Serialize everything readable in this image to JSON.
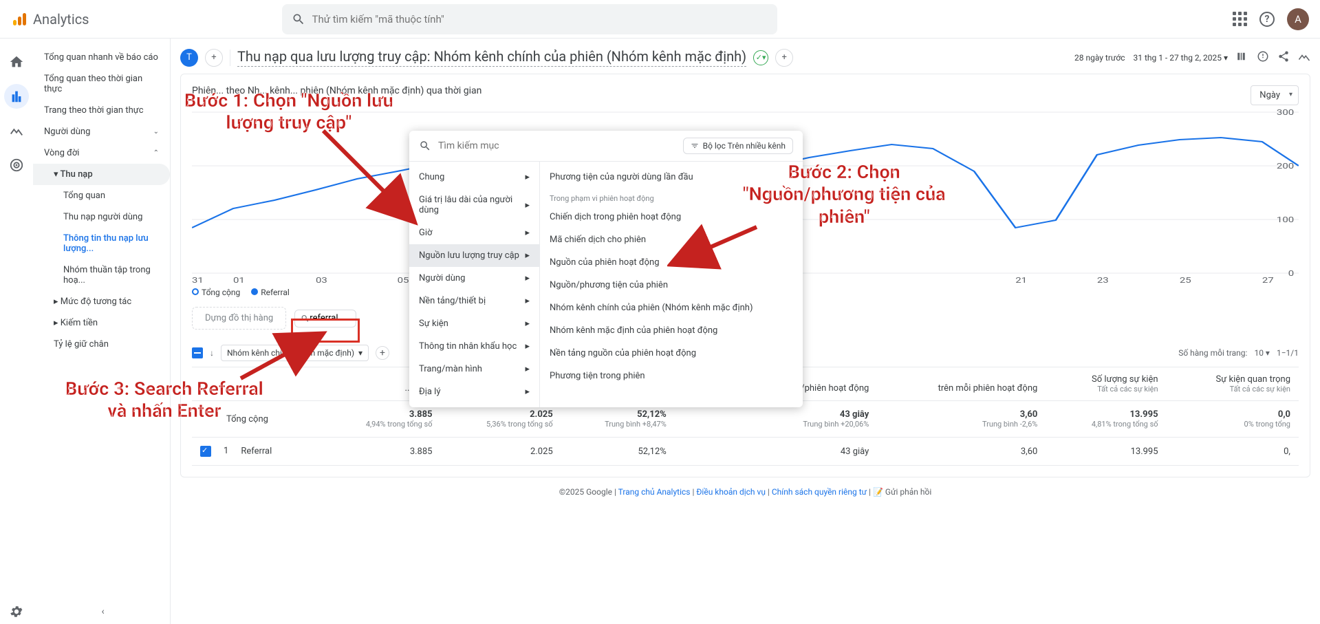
{
  "header": {
    "product": "Analytics",
    "search_placeholder": "Thử tìm kiếm \"mã thuộc tính\"",
    "avatar_letter": "A"
  },
  "sidebar": {
    "overview": "Tổng quan nhanh về báo cáo",
    "realtime_overview": "Tổng quan theo thời gian thực",
    "realtime_pages": "Trang theo thời gian thực",
    "users_section": "Người dùng",
    "lifecycle": "Vòng đời",
    "acquisition": "Thu nạp",
    "acq_overview": "Tổng quan",
    "acq_user": "Thu nạp người dùng",
    "acq_traffic": "Thông tin thu nạp lưu lượng...",
    "acq_cohort": "Nhóm thuần tập trong hoạ...",
    "engagement": "Mức độ tương tác",
    "monetization": "Kiếm tiền",
    "retention": "Tỷ lệ giữ chân"
  },
  "toolbar": {
    "chip_t": "T",
    "title": "Thu nạp qua lưu lượng truy cập: Nhóm kênh chính của phiên (Nhóm kênh mặc định)",
    "date_label": "28 ngày trước",
    "date_range": "31 thg 1 - 27 thg 2, 2025"
  },
  "card": {
    "title": "Phiên... theo Nh... kênh... phiên (Nhóm kênh mặc định) qua thời gian",
    "day_select": "Ngày",
    "legend_total": "Tổng cộng",
    "legend_ref": "Referral",
    "pill_placeholder": "Dựng đồ thị hàng",
    "search_value": "referral"
  },
  "chart_data": {
    "type": "line",
    "ylim": [
      0,
      300
    ],
    "y_ticks": [
      0,
      100,
      200,
      300
    ],
    "x_categories": [
      "31 thg",
      "01",
      "03",
      "05",
      "21",
      "23",
      "25",
      "27"
    ],
    "series": [
      {
        "name": "Tổng cộng",
        "values": [
          85,
          120,
          135,
          155,
          175,
          190,
          205,
          222,
          230,
          236,
          236,
          210,
          90,
          95,
          198,
          215,
          228,
          240,
          232,
          190,
          85,
          98,
          220,
          238,
          248,
          253,
          245,
          200
        ]
      },
      {
        "name": "Referral",
        "values": [
          85,
          120,
          135,
          155,
          175,
          190,
          205,
          222,
          230,
          236,
          236,
          210,
          90,
          95,
          198,
          215,
          228,
          240,
          232,
          190,
          85,
          98,
          220,
          238,
          248,
          253,
          245,
          200
        ]
      }
    ]
  },
  "dropdown": {
    "search_placeholder": "Tìm kiếm mục",
    "filter_chip": "Bộ lọc Trên nhiều kênh",
    "left": {
      "chung": "Chung",
      "gia_tri": "Giá trị lâu dài của người dùng",
      "gio": "Giờ",
      "traffic": "Nguồn lưu lượng truy cập",
      "nguoi_dung": "Người dùng",
      "nen_tang": "Nền tảng/thiết bị",
      "su_kien": "Sự kiện",
      "nhan_khau": "Thông tin nhân khẩu học",
      "trang": "Trang/màn hình",
      "dia_ly": "Địa lý"
    },
    "right": {
      "header1": "Phương tiện của người dùng lần đầu",
      "scope_header": "Trong phạm vi phiên hoạt động",
      "campaign": "Chiến dịch trong phiên hoạt động",
      "campaign_id": "Mã chiến dịch cho phiên",
      "source": "Nguồn của phiên hoạt động",
      "source_medium": "Nguồn/phương tiện của phiên",
      "channel_group": "Nhóm kênh chính của phiên (Nhóm kênh mặc định)",
      "default_channel": "Nhóm kênh mặc định của phiên hoạt động",
      "source_platform": "Nền tảng nguồn của phiên hoạt động",
      "medium": "Phương tiện trong phiên"
    }
  },
  "table": {
    "rows_label": "Số hàng mỗi trang:",
    "rows_value": "10",
    "rows_range": "1−1/1",
    "dim_label": "Nhóm kênh chính...kênh mặc định)",
    "headers": {
      "sessions": "...động",
      "engaged_sessions": "...tác",
      "engagement_rate": "...tác",
      "avg_time": "tác trung bình/phiên hoạt động",
      "events_per_session": "trên mỗi phiên hoạt động",
      "event_count": "Số lượng sự kiện",
      "event_count_sub": "Tất cả các sự kiện",
      "key_events": "Sự kiện quan trọng",
      "key_events_sub": "Tất cả các sự kiện"
    },
    "totals_row": {
      "label": "Tổng cộng",
      "sessions": "3.885",
      "sessions_sub": "4,94% trong tổng số",
      "engaged": "2.025",
      "engaged_sub": "5,36% trong tổng số",
      "rate": "52,12%",
      "rate_sub": "Trung bình +8,47%",
      "time": "43 giây",
      "time_sub": "Trung bình +20,06%",
      "eps": "3,60",
      "eps_sub": "Trung bình -2,6%",
      "count": "13.995",
      "count_sub": "4,81% trong tổng số",
      "key": "0,0",
      "key_sub": "0% trong tổng"
    },
    "data_row": {
      "idx": "1",
      "name": "Referral",
      "sessions": "3.885",
      "engaged": "2.025",
      "rate": "52,12%",
      "time": "43 giây",
      "eps": "3,60",
      "count": "13.995",
      "key": "0,"
    }
  },
  "annotations": {
    "step1a": "Bước 1: Chọn \"Nguồn lưu",
    "step1b": "lượng truy cập\"",
    "step2a": "Bước 2: Chọn",
    "step2b": "\"Nguồn/phương tiện của",
    "step2c": "phiên\"",
    "step3a": "Bước 3: Search Referral",
    "step3b": "và nhấn Enter"
  },
  "footer": {
    "copyright": "©2025 Google",
    "home": "Trang chủ Analytics",
    "terms": "Điều khoản dịch vụ",
    "privacy": "Chính sách quyền riêng tư",
    "feedback": "Gửi phản hồi"
  }
}
